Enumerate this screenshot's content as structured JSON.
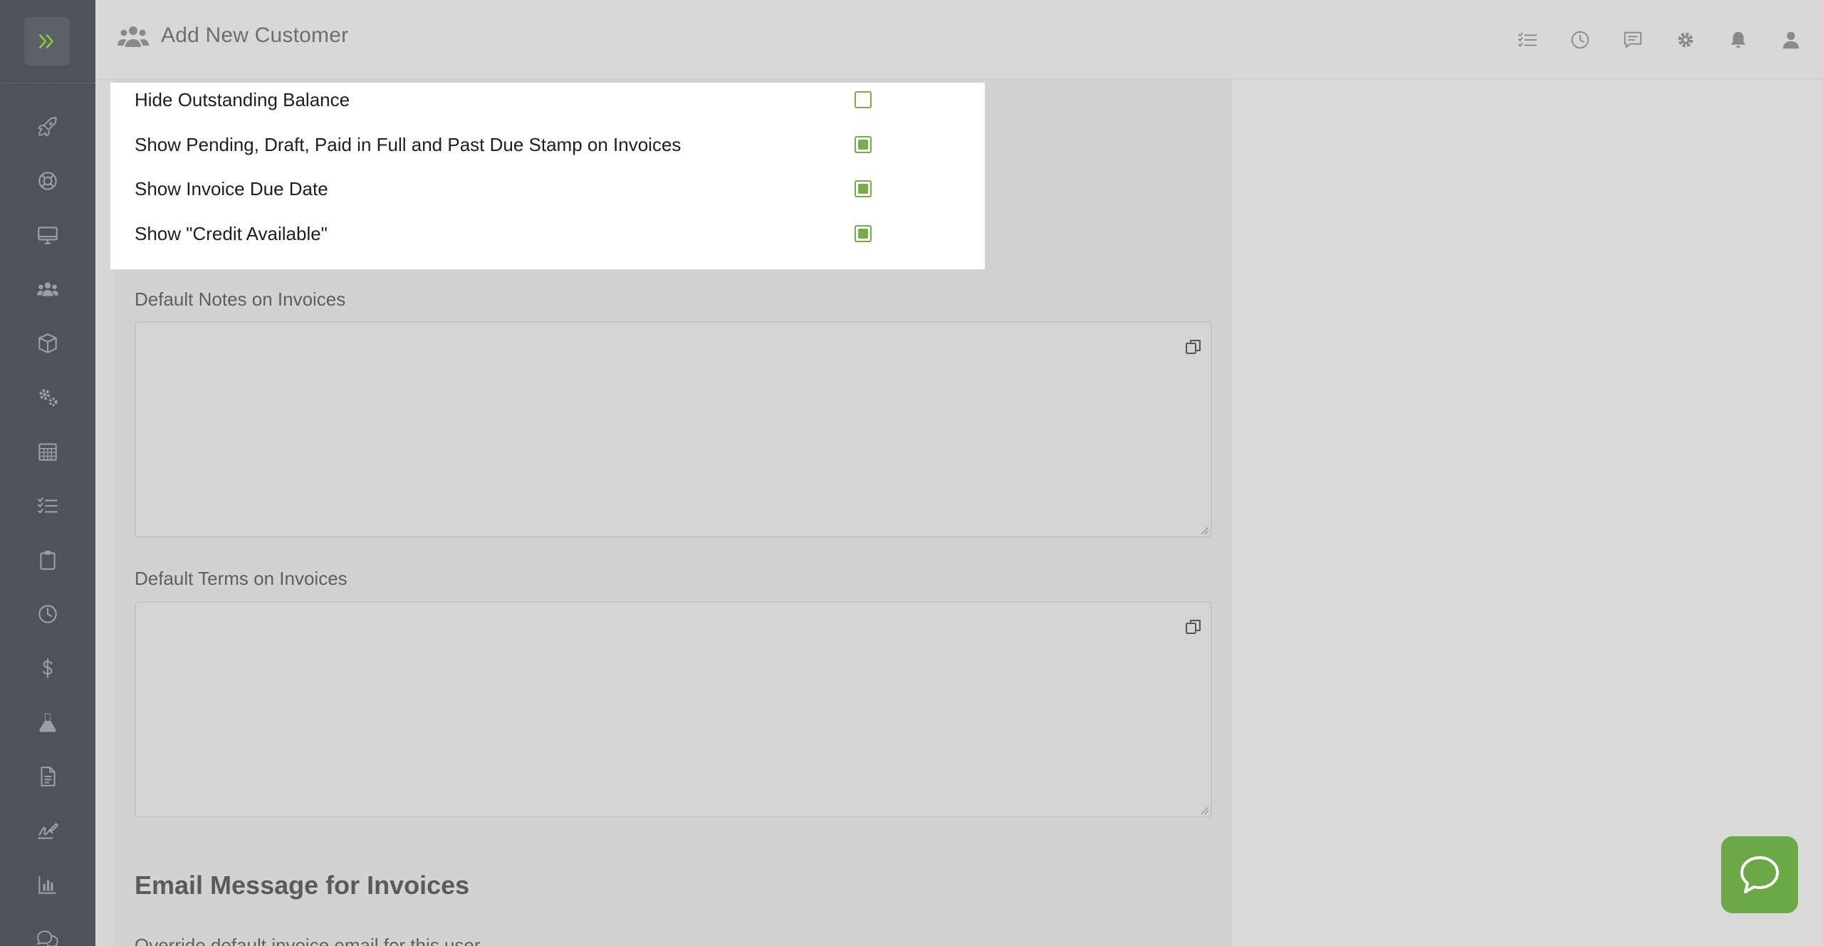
{
  "header": {
    "title": "Add New Customer",
    "title_icon": "users-icon",
    "actions": [
      {
        "name": "tasks-icon"
      },
      {
        "name": "history-icon"
      },
      {
        "name": "messages-icon"
      },
      {
        "name": "settings-icon"
      },
      {
        "name": "notifications-icon"
      },
      {
        "name": "user-profile-icon"
      }
    ]
  },
  "sidebar": {
    "toggle_icon": "expand-chevrons-icon",
    "items": [
      {
        "icon": "rocket-icon"
      },
      {
        "icon": "lifebuoy-icon"
      },
      {
        "icon": "monitor-icon"
      },
      {
        "icon": "customers-icon"
      },
      {
        "icon": "box-icon"
      },
      {
        "icon": "gears-icon"
      },
      {
        "icon": "calendar-icon"
      },
      {
        "icon": "checklist-icon"
      },
      {
        "icon": "clipboard-icon"
      },
      {
        "icon": "clock-icon"
      },
      {
        "icon": "dollar-icon"
      },
      {
        "icon": "flask-icon"
      },
      {
        "icon": "document-icon"
      },
      {
        "icon": "signature-icon"
      },
      {
        "icon": "bar-chart-icon"
      },
      {
        "icon": "chat-bubbles-icon"
      }
    ]
  },
  "options": [
    {
      "label": "Hide Outstanding Balance",
      "checked": false
    },
    {
      "label": "Show Pending, Draft, Paid in Full and Past Due Stamp on Invoices",
      "checked": true
    },
    {
      "label": "Show Invoice Due Date",
      "checked": true
    },
    {
      "label": "Show \"Credit Available\"",
      "checked": true
    }
  ],
  "fields": {
    "notes_label": "Default Notes on Invoices",
    "notes_value": "",
    "terms_label": "Default Terms on Invoices",
    "terms_value": ""
  },
  "email_section": {
    "heading": "Email Message for Invoices",
    "override_label": "Override default invoice email for this user"
  },
  "colors": {
    "accent": "#78ad4e",
    "sidebar": "#4d535b",
    "chat_button": "#6da846"
  }
}
